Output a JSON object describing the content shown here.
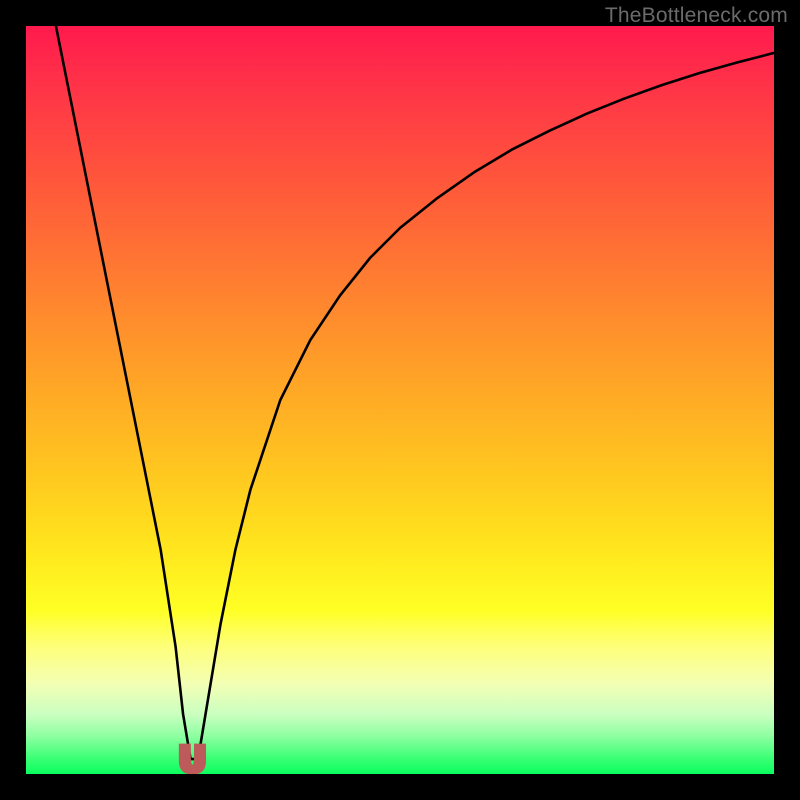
{
  "watermark": "TheBottleneck.com",
  "colors": {
    "background": "#000000",
    "curve_stroke": "#000000",
    "marker_fill": "#bd5a5a",
    "marker_stroke": "#bd5a5a"
  },
  "chart_data": {
    "type": "line",
    "title": "",
    "xlabel": "",
    "ylabel": "",
    "xlim": [
      0,
      100
    ],
    "ylim": [
      0,
      100
    ],
    "grid": false,
    "legend": false,
    "series": [
      {
        "name": "bottleneck-curve",
        "x": [
          4,
          6,
          8,
          10,
          12,
          14,
          16,
          18,
          20,
          21,
          22,
          23,
          24,
          26,
          28,
          30,
          34,
          38,
          42,
          46,
          50,
          55,
          60,
          65,
          70,
          75,
          80,
          85,
          90,
          95,
          100
        ],
        "values": [
          100,
          90,
          80,
          70,
          60,
          50,
          40,
          30,
          17,
          8,
          2,
          2,
          8,
          20,
          30,
          38,
          50,
          58,
          64,
          69,
          73,
          77,
          80.5,
          83.5,
          86,
          88.3,
          90.3,
          92.1,
          93.7,
          95.1,
          96.4
        ]
      }
    ],
    "marker": {
      "name": "optimal-point",
      "x_range": [
        20.5,
        24
      ],
      "y_range": [
        0,
        4
      ],
      "shape": "U"
    }
  }
}
